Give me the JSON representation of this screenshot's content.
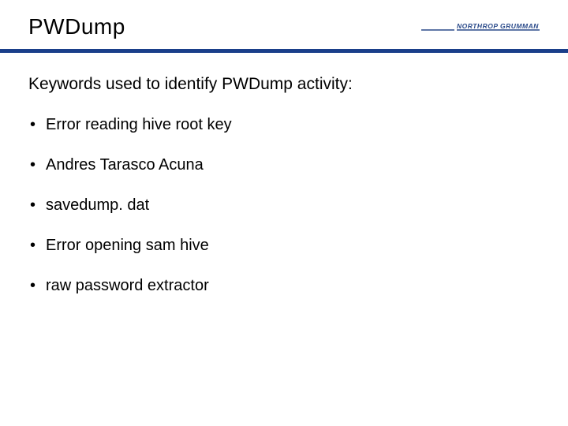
{
  "header": {
    "title": "PWDump",
    "logo_text_top": "NORTHROP GRUMMAN"
  },
  "subtitle": "Keywords used to identify PWDump activity:",
  "bullets": [
    "Error reading hive root key",
    "Andres Tarasco Acuna",
    "savedump. dat",
    "Error opening sam hive",
    "raw password extractor"
  ]
}
